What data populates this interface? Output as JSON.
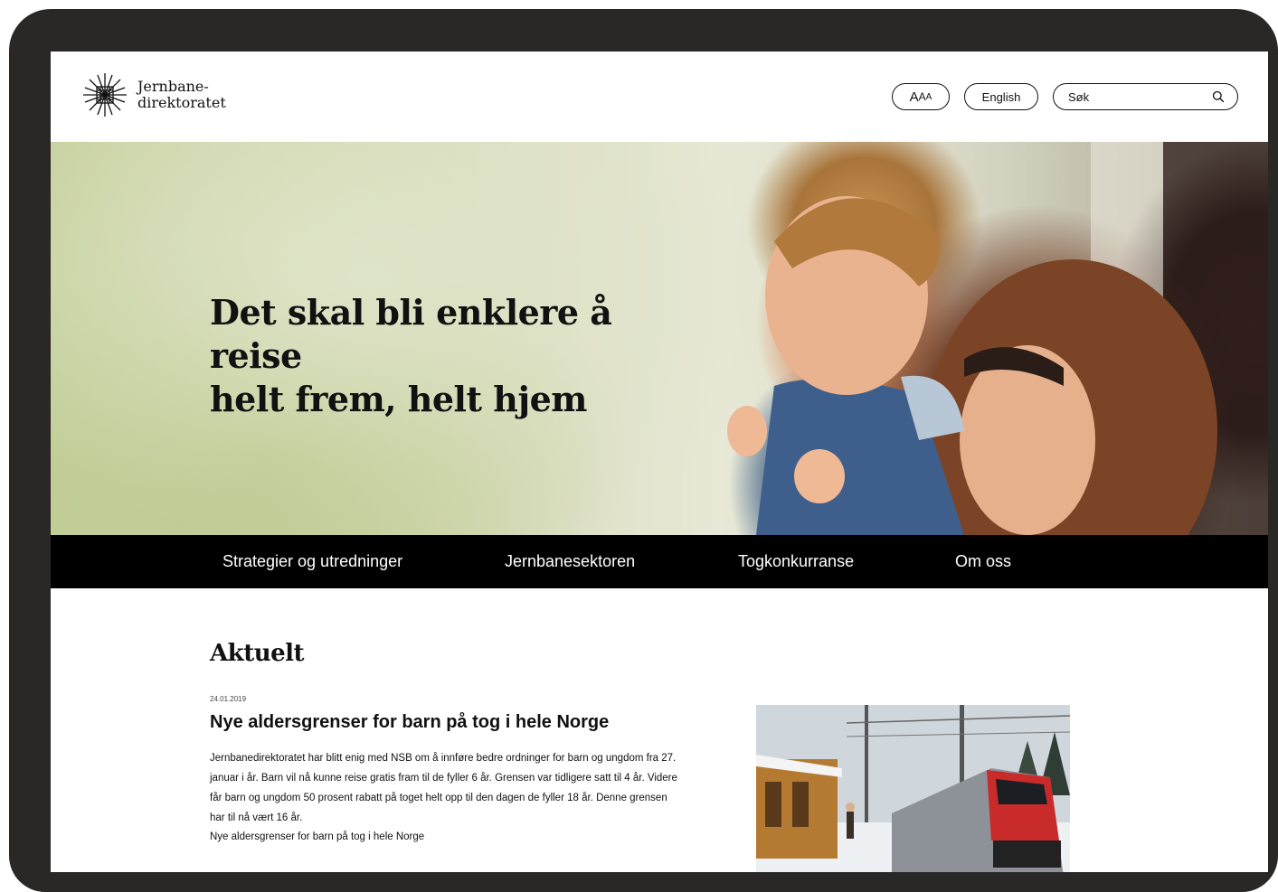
{
  "header": {
    "logo_line1": "Jernbane-",
    "logo_line2": "direktoratet",
    "text_size_label_big": "A",
    "text_size_label_mid": "A",
    "text_size_label_small": "A",
    "language_label": "English",
    "search_placeholder": "Søk"
  },
  "hero": {
    "title_line1": "Det skal bli enklere å reise",
    "title_line2": "helt frem, helt hjem"
  },
  "nav": {
    "items": [
      {
        "label": "Strategier og utredninger"
      },
      {
        "label": "Jernbanesektoren"
      },
      {
        "label": "Togkonkurranse"
      },
      {
        "label": "Om oss"
      }
    ]
  },
  "news": {
    "section_title": "Aktuelt",
    "date": "24.01.2019",
    "headline": "Nye aldersgrenser for barn på tog i hele Norge",
    "body": "Jernbanedirektoratet har blitt enig med NSB om å innføre bedre ordninger for barn og ungdom fra 27. januar i år. Barn vil nå kunne reise gratis fram til de fyller 6 år. Grensen var tidligere satt til 4 år. Videre får barn og ungdom 50 prosent rabatt på toget helt opp til den dagen de fyller 18 år. Denne grensen har til nå vært 16 år.",
    "link_text": "Nye aldersgrenser for barn på tog i hele Norge"
  },
  "colors": {
    "nav_background": "#000000",
    "device_frame": "#2a2727",
    "text": "#111111"
  }
}
